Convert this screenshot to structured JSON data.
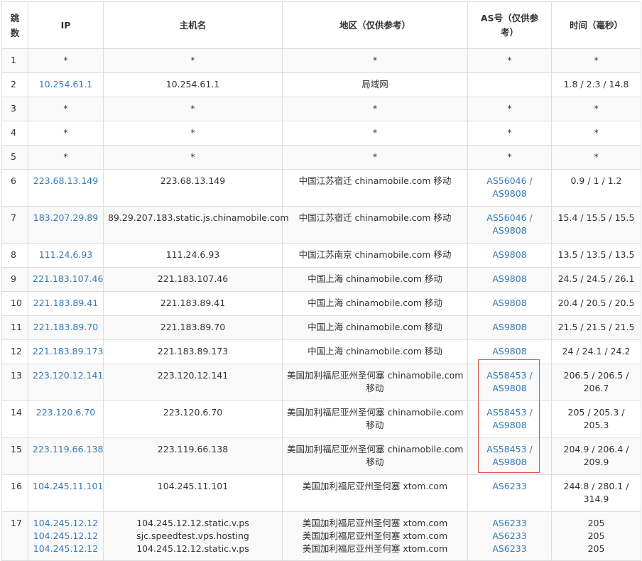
{
  "headers": {
    "hop": "跳数",
    "ip": "IP",
    "host": "主机名",
    "region": "地区（仅供参考）",
    "as": "AS号（仅供参考）",
    "time": "时间（毫秒）"
  },
  "rows": [
    {
      "hop": "1",
      "ip": [
        "*"
      ],
      "host": [
        "*"
      ],
      "region": [
        "*"
      ],
      "as": [
        "*"
      ],
      "time": [
        "*"
      ],
      "ip_link": false,
      "as_link": false
    },
    {
      "hop": "2",
      "ip": [
        "10.254.61.1"
      ],
      "host": [
        "10.254.61.1"
      ],
      "region": [
        "局域网"
      ],
      "as": [
        ""
      ],
      "time": [
        "1.8 / 2.3 / 14.8"
      ],
      "ip_link": true,
      "as_link": true
    },
    {
      "hop": "3",
      "ip": [
        "*"
      ],
      "host": [
        "*"
      ],
      "region": [
        "*"
      ],
      "as": [
        "*"
      ],
      "time": [
        "*"
      ],
      "ip_link": false,
      "as_link": false
    },
    {
      "hop": "4",
      "ip": [
        "*"
      ],
      "host": [
        "*"
      ],
      "region": [
        "*"
      ],
      "as": [
        "*"
      ],
      "time": [
        "*"
      ],
      "ip_link": false,
      "as_link": false
    },
    {
      "hop": "5",
      "ip": [
        "*"
      ],
      "host": [
        "*"
      ],
      "region": [
        "*"
      ],
      "as": [
        "*"
      ],
      "time": [
        "*"
      ],
      "ip_link": false,
      "as_link": false
    },
    {
      "hop": "6",
      "ip": [
        "223.68.13.149"
      ],
      "host": [
        "223.68.13.149"
      ],
      "region": [
        "中国江苏宿迁 chinamobile.com 移动"
      ],
      "as": [
        "AS56046 /",
        "AS9808"
      ],
      "time": [
        "0.9 / 1 / 1.2"
      ],
      "ip_link": true,
      "as_link": true
    },
    {
      "hop": "7",
      "ip": [
        "183.207.29.89"
      ],
      "host": [
        "89.29.207.183.static.js.chinamobile.com"
      ],
      "region": [
        "中国江苏宿迁 chinamobile.com 移动"
      ],
      "as": [
        "AS56046 /",
        "AS9808"
      ],
      "time": [
        "15.4 / 15.5 / 15.5"
      ],
      "ip_link": true,
      "as_link": true
    },
    {
      "hop": "8",
      "ip": [
        "111.24.6.93"
      ],
      "host": [
        "111.24.6.93"
      ],
      "region": [
        "中国江苏南京 chinamobile.com 移动"
      ],
      "as": [
        "AS9808"
      ],
      "time": [
        "13.5 / 13.5 / 13.5"
      ],
      "ip_link": true,
      "as_link": true
    },
    {
      "hop": "9",
      "ip": [
        "221.183.107.46"
      ],
      "host": [
        "221.183.107.46"
      ],
      "region": [
        "中国上海 chinamobile.com 移动"
      ],
      "as": [
        "AS9808"
      ],
      "time": [
        "24.5 / 24.5 / 26.1"
      ],
      "ip_link": true,
      "as_link": true
    },
    {
      "hop": "10",
      "ip": [
        "221.183.89.41"
      ],
      "host": [
        "221.183.89.41"
      ],
      "region": [
        "中国上海 chinamobile.com 移动"
      ],
      "as": [
        "AS9808"
      ],
      "time": [
        "20.4 / 20.5 / 20.5"
      ],
      "ip_link": true,
      "as_link": true
    },
    {
      "hop": "11",
      "ip": [
        "221.183.89.70"
      ],
      "host": [
        "221.183.89.70"
      ],
      "region": [
        "中国上海 chinamobile.com 移动"
      ],
      "as": [
        "AS9808"
      ],
      "time": [
        "21.5 / 21.5 / 21.5"
      ],
      "ip_link": true,
      "as_link": true
    },
    {
      "hop": "12",
      "ip": [
        "221.183.89.173"
      ],
      "host": [
        "221.183.89.173"
      ],
      "region": [
        "中国上海 chinamobile.com 移动"
      ],
      "as": [
        "AS9808"
      ],
      "time": [
        "24 / 24.1 / 24.2"
      ],
      "ip_link": true,
      "as_link": true
    },
    {
      "hop": "13",
      "ip": [
        "223.120.12.141"
      ],
      "host": [
        "223.120.12.141"
      ],
      "region": [
        "美国加利福尼亚州圣何塞 chinamobile.com",
        "移动"
      ],
      "as": [
        "AS58453 /",
        "AS9808"
      ],
      "time": [
        "206.5 / 206.5 /",
        "206.7"
      ],
      "ip_link": true,
      "as_link": true
    },
    {
      "hop": "14",
      "ip": [
        "223.120.6.70"
      ],
      "host": [
        "223.120.6.70"
      ],
      "region": [
        "美国加利福尼亚州圣何塞 chinamobile.com",
        "移动"
      ],
      "as": [
        "AS58453 /",
        "AS9808"
      ],
      "time": [
        "205 / 205.3 /",
        "205.3"
      ],
      "ip_link": true,
      "as_link": true
    },
    {
      "hop": "15",
      "ip": [
        "223.119.66.138"
      ],
      "host": [
        "223.119.66.138"
      ],
      "region": [
        "美国加利福尼亚州圣何塞 chinamobile.com",
        "移动"
      ],
      "as": [
        "AS58453 /",
        "AS9808"
      ],
      "time": [
        "204.9 / 206.4 /",
        "209.9"
      ],
      "ip_link": true,
      "as_link": true
    },
    {
      "hop": "16",
      "ip": [
        "104.245.11.101"
      ],
      "host": [
        "104.245.11.101"
      ],
      "region": [
        "美国加利福尼亚州圣何塞 xtom.com"
      ],
      "as": [
        "AS6233"
      ],
      "time": [
        "244.8 / 280.1 /",
        "314.9"
      ],
      "ip_link": true,
      "as_link": true
    },
    {
      "hop": "17",
      "ip": [
        "104.245.12.12",
        "104.245.12.12",
        "104.245.12.12"
      ],
      "host": [
        "104.245.12.12.static.v.ps",
        "sjc.speedtest.vps.hosting",
        "104.245.12.12.static.v.ps"
      ],
      "region": [
        "美国加利福尼亚州圣何塞 xtom.com",
        "美国加利福尼亚州圣何塞 xtom.com",
        "美国加利福尼亚州圣何塞 xtom.com"
      ],
      "as": [
        "AS6233",
        "AS6233",
        "AS6233"
      ],
      "time": [
        "205",
        "205",
        "205"
      ],
      "ip_link": true,
      "as_link": true
    }
  ],
  "colors": {
    "link": "#337ab7",
    "highlight": "#d9534f",
    "stripe": "#f9f9f9",
    "border": "#dddddd"
  }
}
